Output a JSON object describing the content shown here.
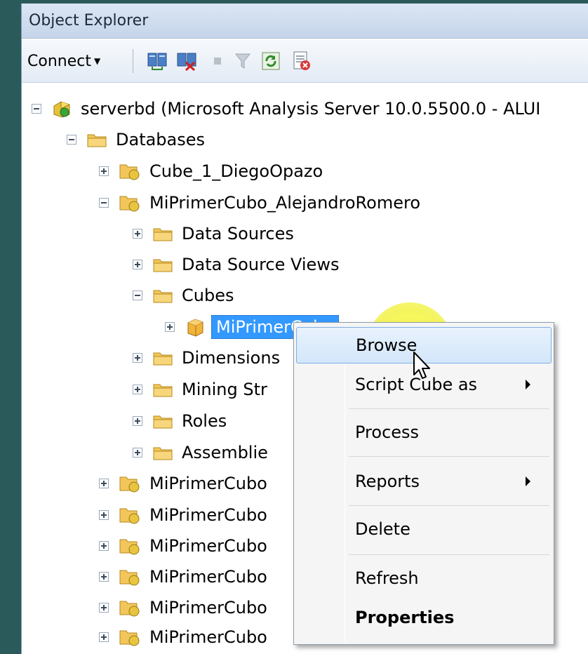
{
  "window": {
    "title": "Object Explorer"
  },
  "toolbar": {
    "connect_label": "Connect",
    "icons": [
      "connect-object-icon",
      "disconnect-icon",
      "stop-icon",
      "filter-icon",
      "refresh-icon",
      "new-query-icon"
    ]
  },
  "tree": {
    "server": "serverbd (Microsoft Analysis Server 10.0.5500.0 - ALUI",
    "databases": "Databases",
    "db_cube1": "Cube_1_DiegoOpazo",
    "db_alejandro": "MiPrimerCubo_AlejandroRomero",
    "data_sources": "Data Sources",
    "data_source_views": "Data Source Views",
    "cubes": "Cubes",
    "selected_cube": "MiPrimerCubo",
    "dimensions": "Dimensions",
    "mining_structures": "Mining Str",
    "roles": "Roles",
    "assemblies": "Assemblie",
    "db_truncated_1": "MiPrimerCubo",
    "db_truncated_2": "MiPrimerCubo",
    "db_truncated_3": "MiPrimerCubo",
    "db_truncated_4": "MiPrimerCubo",
    "db_truncated_5": "MiPrimerCubo",
    "db_truncated_6": "MiPrimerCubo"
  },
  "context_menu": {
    "browse": "Browse",
    "script_cube_as": "Script Cube as",
    "process": "Process",
    "reports": "Reports",
    "delete": "Delete",
    "refresh": "Refresh",
    "properties": "Properties"
  }
}
